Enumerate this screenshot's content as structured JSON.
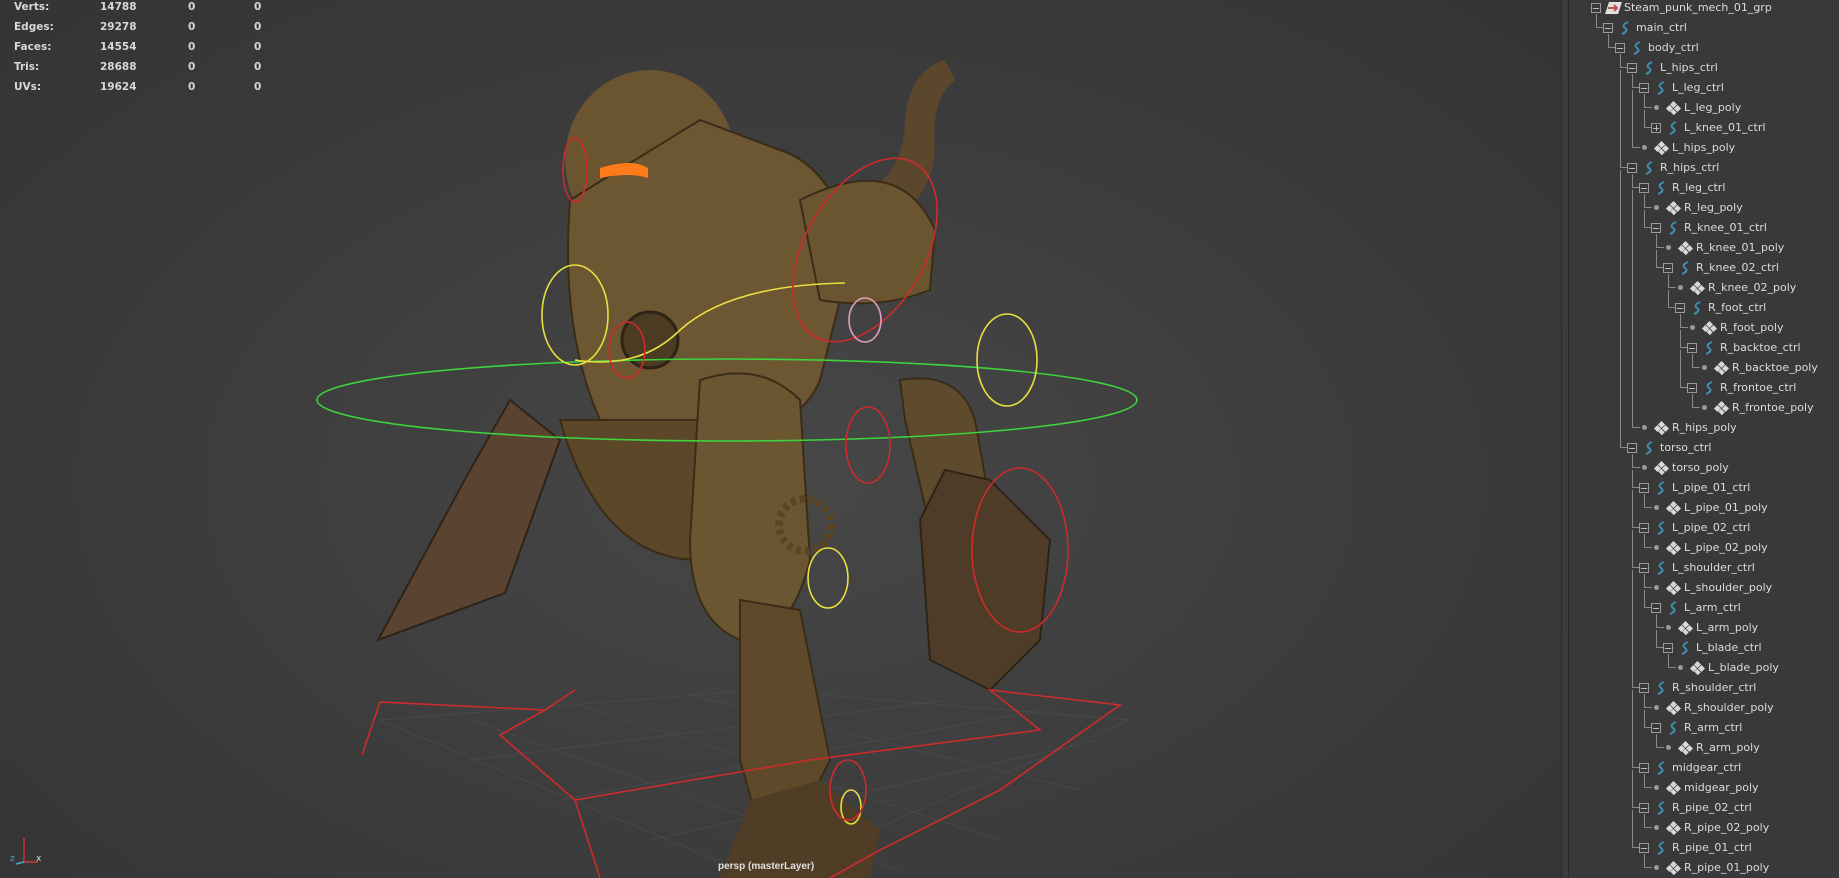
{
  "hud": {
    "rows": [
      {
        "label": "Verts:",
        "value": "14788",
        "sel": "0",
        "uv": "0"
      },
      {
        "label": "Edges:",
        "value": "29278",
        "sel": "0",
        "uv": "0"
      },
      {
        "label": "Faces:",
        "value": "14554",
        "sel": "0",
        "uv": "0"
      },
      {
        "label": "Tris:",
        "value": "28688",
        "sel": "0",
        "uv": "0"
      },
      {
        "label": "UVs:",
        "value": "19624",
        "sel": "0",
        "uv": "0"
      }
    ]
  },
  "viewport": {
    "camera_label": "persp (masterLayer)",
    "axis": {
      "z": "z",
      "x": "x"
    }
  },
  "outliner": {
    "items": [
      {
        "label": "Steam_punk_mech_01_grp",
        "depth": 0,
        "type": "group",
        "expander": "open"
      },
      {
        "label": "main_ctrl",
        "depth": 1,
        "type": "curve",
        "expander": "open"
      },
      {
        "label": "body_ctrl",
        "depth": 2,
        "type": "curve",
        "expander": "open"
      },
      {
        "label": "L_hips_ctrl",
        "depth": 3,
        "type": "curve",
        "expander": "open"
      },
      {
        "label": "L_leg_ctrl",
        "depth": 4,
        "type": "curve",
        "expander": "open"
      },
      {
        "label": "L_leg_poly",
        "depth": 5,
        "type": "mesh",
        "expander": "none"
      },
      {
        "label": "L_knee_01_ctrl",
        "depth": 5,
        "type": "curve",
        "expander": "closed"
      },
      {
        "label": "L_hips_poly",
        "depth": 4,
        "type": "mesh",
        "expander": "none"
      },
      {
        "label": "R_hips_ctrl",
        "depth": 3,
        "type": "curve",
        "expander": "open"
      },
      {
        "label": "R_leg_ctrl",
        "depth": 4,
        "type": "curve",
        "expander": "open"
      },
      {
        "label": "R_leg_poly",
        "depth": 5,
        "type": "mesh",
        "expander": "none"
      },
      {
        "label": "R_knee_01_ctrl",
        "depth": 5,
        "type": "curve",
        "expander": "open"
      },
      {
        "label": "R_knee_01_poly",
        "depth": 6,
        "type": "mesh",
        "expander": "none"
      },
      {
        "label": "R_knee_02_ctrl",
        "depth": 6,
        "type": "curve",
        "expander": "open"
      },
      {
        "label": "R_knee_02_poly",
        "depth": 7,
        "type": "mesh",
        "expander": "none"
      },
      {
        "label": "R_foot_ctrl",
        "depth": 7,
        "type": "curve",
        "expander": "open"
      },
      {
        "label": "R_foot_poly",
        "depth": 8,
        "type": "mesh",
        "expander": "none"
      },
      {
        "label": "R_backtoe_ctrl",
        "depth": 8,
        "type": "curve",
        "expander": "open"
      },
      {
        "label": "R_backtoe_poly",
        "depth": 9,
        "type": "mesh",
        "expander": "none"
      },
      {
        "label": "R_frontoe_ctrl",
        "depth": 8,
        "type": "curve",
        "expander": "open"
      },
      {
        "label": "R_frontoe_poly",
        "depth": 9,
        "type": "mesh",
        "expander": "none"
      },
      {
        "label": "R_hips_poly",
        "depth": 4,
        "type": "mesh",
        "expander": "none"
      },
      {
        "label": "torso_ctrl",
        "depth": 3,
        "type": "curve",
        "expander": "open"
      },
      {
        "label": "torso_poly",
        "depth": 4,
        "type": "mesh",
        "expander": "none"
      },
      {
        "label": "L_pipe_01_ctrl",
        "depth": 4,
        "type": "curve",
        "expander": "open"
      },
      {
        "label": "L_pipe_01_poly",
        "depth": 5,
        "type": "mesh",
        "expander": "none"
      },
      {
        "label": "L_pipe_02_ctrl",
        "depth": 4,
        "type": "curve",
        "expander": "open"
      },
      {
        "label": "L_pipe_02_poly",
        "depth": 5,
        "type": "mesh",
        "expander": "none"
      },
      {
        "label": "L_shoulder_ctrl",
        "depth": 4,
        "type": "curve",
        "expander": "open"
      },
      {
        "label": "L_shoulder_poly",
        "depth": 5,
        "type": "mesh",
        "expander": "none"
      },
      {
        "label": "L_arm_ctrl",
        "depth": 5,
        "type": "curve",
        "expander": "open"
      },
      {
        "label": "L_arm_poly",
        "depth": 6,
        "type": "mesh",
        "expander": "none"
      },
      {
        "label": "L_blade_ctrl",
        "depth": 6,
        "type": "curve",
        "expander": "open"
      },
      {
        "label": "L_blade_poly",
        "depth": 7,
        "type": "mesh",
        "expander": "none"
      },
      {
        "label": "R_shoulder_ctrl",
        "depth": 4,
        "type": "curve",
        "expander": "open"
      },
      {
        "label": "R_shoulder_poly",
        "depth": 5,
        "type": "mesh",
        "expander": "none"
      },
      {
        "label": "R_arm_ctrl",
        "depth": 5,
        "type": "curve",
        "expander": "open"
      },
      {
        "label": "R_arm_poly",
        "depth": 6,
        "type": "mesh",
        "expander": "none"
      },
      {
        "label": "midgear_ctrl",
        "depth": 4,
        "type": "curve",
        "expander": "open"
      },
      {
        "label": "midgear_poly",
        "depth": 5,
        "type": "mesh",
        "expander": "none"
      },
      {
        "label": "R_pipe_02_ctrl",
        "depth": 4,
        "type": "curve",
        "expander": "open"
      },
      {
        "label": "R_pipe_02_poly",
        "depth": 5,
        "type": "mesh",
        "expander": "none"
      },
      {
        "label": "R_pipe_01_ctrl",
        "depth": 4,
        "type": "curve",
        "expander": "open"
      },
      {
        "label": "R_pipe_01_poly",
        "depth": 5,
        "type": "mesh",
        "expander": "none"
      }
    ]
  },
  "colors": {
    "curve_icon": "#3f8fb0",
    "group_icon": "#c0504d",
    "ctrl_green": "#3ed43e",
    "ctrl_yellow": "#e8e040",
    "ctrl_red": "#d02a2a",
    "visor": "#ff7a1a"
  }
}
